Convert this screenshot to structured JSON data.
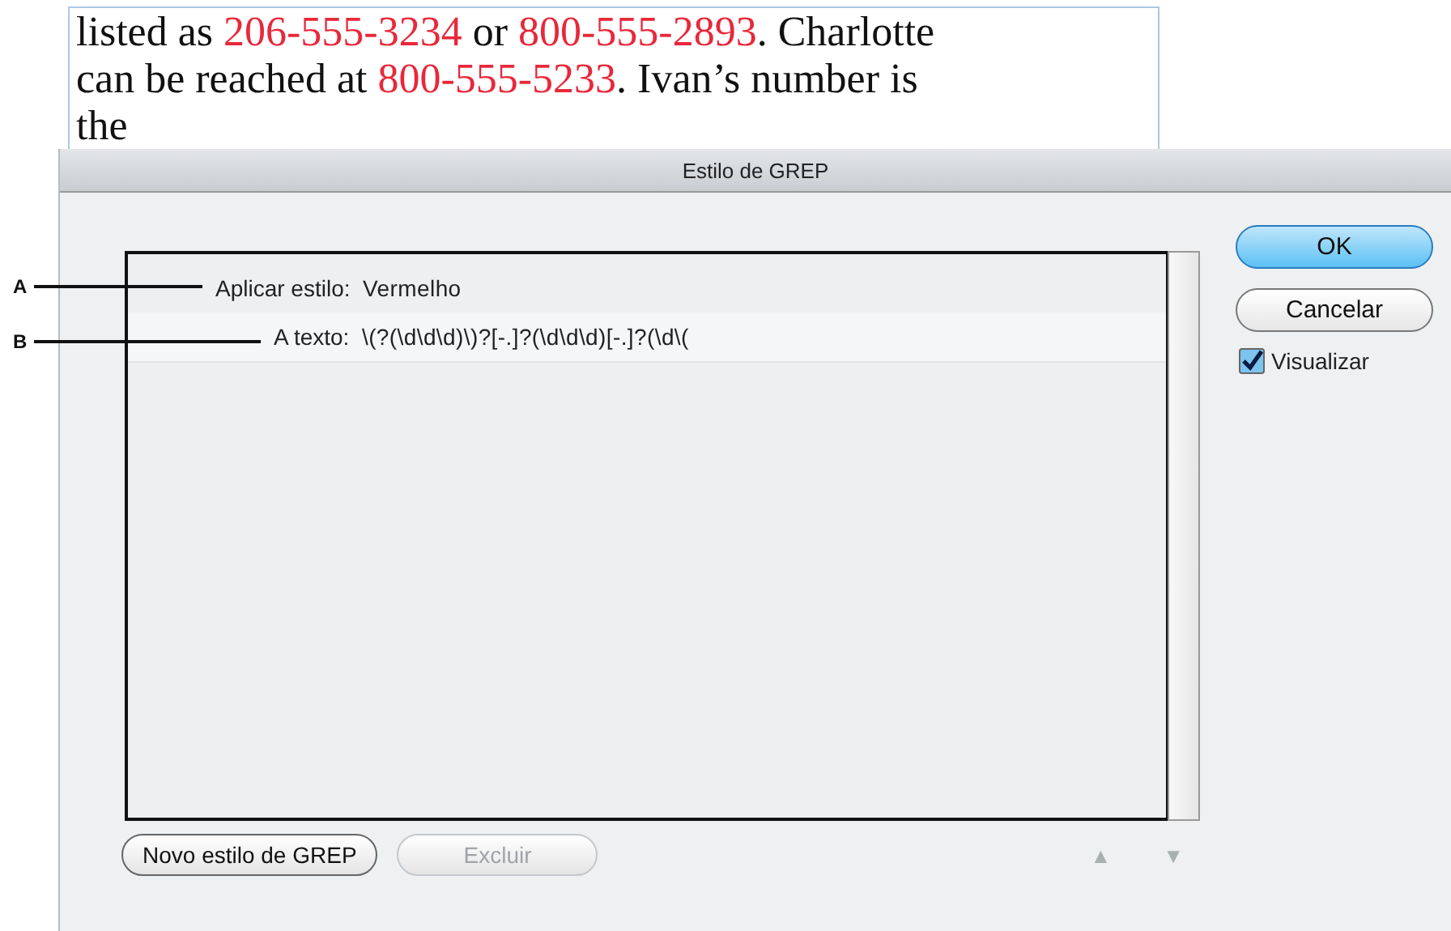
{
  "document": {
    "lines": [
      [
        {
          "text": "listed as ",
          "highlighted": false
        },
        {
          "text": "206-555-3234",
          "highlighted": true
        },
        {
          "text": " or ",
          "highlighted": false
        },
        {
          "text": "800-555-2893",
          "highlighted": true
        },
        {
          "text": ". Charlotte",
          "highlighted": false
        }
      ],
      [
        {
          "text": "can be reached at ",
          "highlighted": false
        },
        {
          "text": "800-555-5233",
          "highlighted": true
        },
        {
          "text": ". Ivan’s number is",
          "highlighted": false
        }
      ],
      [
        {
          "text": "the",
          "highlighted": false
        }
      ]
    ]
  },
  "dialog": {
    "title": "Estilo de GREP",
    "styles": [
      {
        "label": "Aplicar estilo:",
        "value": "Vermelho",
        "selected": false,
        "children": [
          {
            "label": "A texto:",
            "value": "\\(?(\\d\\d\\d)\\)?[-.]?(\\d\\d\\d)[-.]?(\\d\\(",
            "selected": true
          }
        ]
      }
    ],
    "ok_button": "OK",
    "cancel_button": "Cancelar",
    "preview": {
      "label": "Visualizar",
      "checked": true
    },
    "new_button": {
      "label": "Novo estilo de GREP",
      "disabled": false
    },
    "delete_button": {
      "label": "Excluir",
      "disabled": true
    },
    "move_up": {
      "label": "▲",
      "disabled": true
    },
    "move_down": {
      "label": "▼",
      "disabled": true
    }
  },
  "callouts": [
    "A",
    "B"
  ]
}
